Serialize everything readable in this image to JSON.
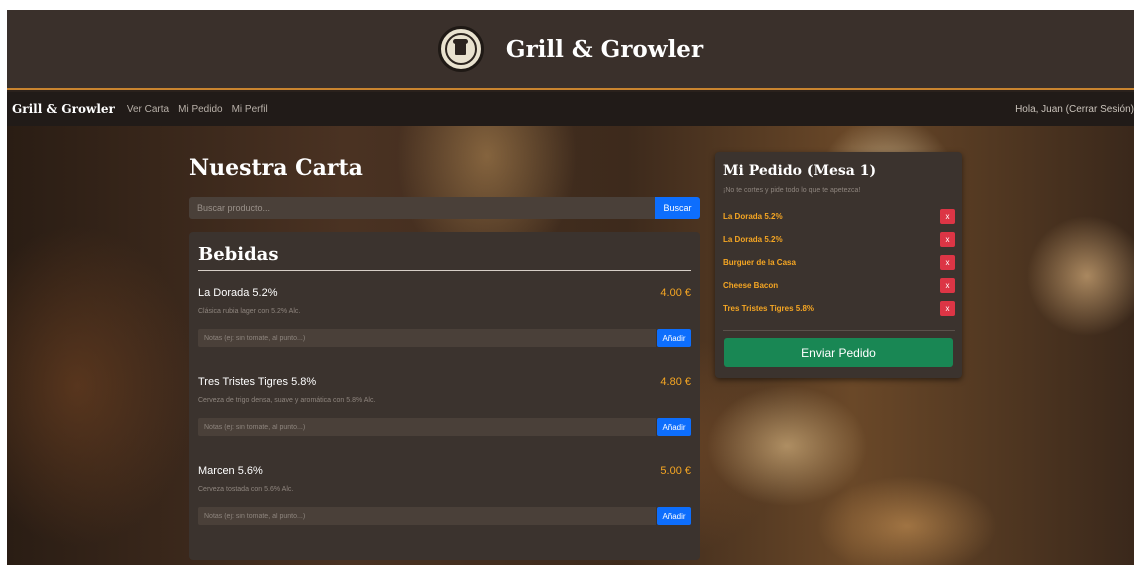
{
  "header": {
    "title": "Grill & Growler",
    "logo": "grill-growler-logo"
  },
  "navbar": {
    "brand": "Grill & Growler",
    "links": [
      "Ver Carta",
      "Mi Pedido",
      "Mi Perfil"
    ],
    "user": "Hola, Juan (Cerrar Sesión)"
  },
  "menu": {
    "title": "Nuestra Carta",
    "search": {
      "placeholder": "Buscar producto...",
      "button": "Buscar"
    },
    "category": "Bebidas",
    "products": [
      {
        "name": "La Dorada 5.2%",
        "price": "4.00 €",
        "description": "Clásica rubia lager con 5.2% Alc.",
        "notes_placeholder": "Notas (ej: sin tomate, al punto...)",
        "add_label": "Añadir"
      },
      {
        "name": "Tres Tristes Tigres 5.8%",
        "price": "4.80 €",
        "description": "Cerveza de trigo densa, suave y aromática con 5.8% Alc.",
        "notes_placeholder": "Notas (ej: sin tomate, al punto...)",
        "add_label": "Añadir"
      },
      {
        "name": "Marcen 5.6%",
        "price": "5.00 €",
        "description": "Cerveza tostada con 5.6% Alc.",
        "notes_placeholder": "Notas (ej: sin tomate, al punto...)",
        "add_label": "Añadir"
      }
    ]
  },
  "order": {
    "title": "Mi Pedido (Mesa 1)",
    "subtitle": "¡No te cortes y pide todo lo que te apetezca!",
    "items": [
      {
        "name": "La Dorada 5.2%",
        "remove": "x"
      },
      {
        "name": "La Dorada 5.2%",
        "remove": "x"
      },
      {
        "name": "Burguer de la Casa",
        "remove": "x"
      },
      {
        "name": "Cheese Bacon",
        "remove": "x"
      },
      {
        "name": "Tres Tristes Tigres 5.8%",
        "remove": "x"
      }
    ],
    "send_button": "Enviar Pedido"
  },
  "colors": {
    "accent": "#f5a623",
    "primary": "#0d6efd",
    "danger": "#dc3545",
    "success": "#198754",
    "header_border": "#c9842f"
  }
}
